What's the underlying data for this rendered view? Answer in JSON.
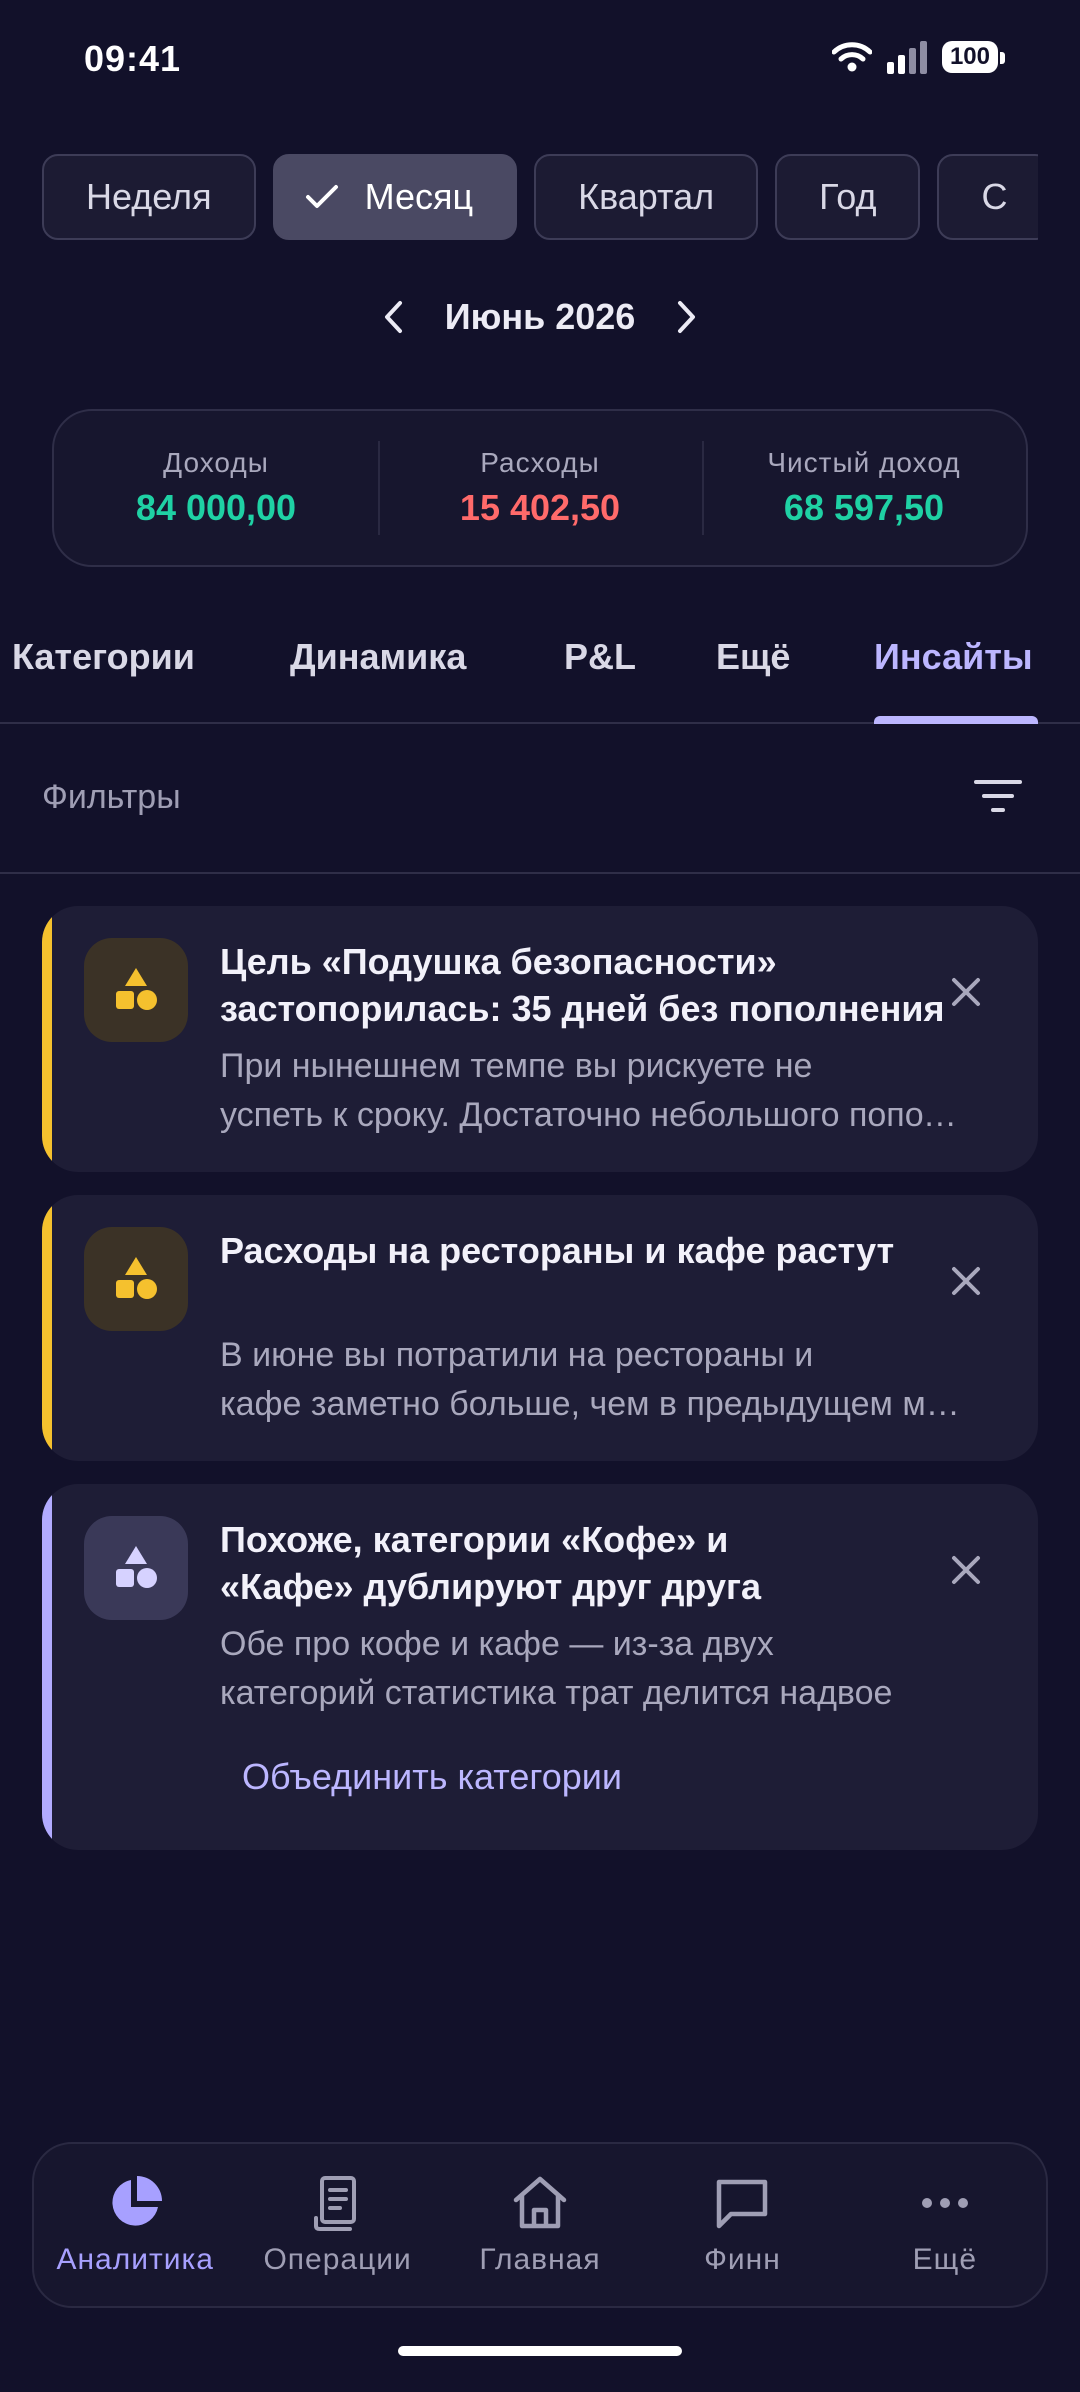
{
  "status": {
    "time": "09:41",
    "battery": "100"
  },
  "periods": [
    "Неделя",
    "Месяц",
    "Квартал",
    "Год",
    "С"
  ],
  "selected_period": "Месяц",
  "month": "Июнь 2026",
  "summary": {
    "income_label": "Доходы",
    "income_value": "84 000,00",
    "income_color": "#1fd1a4",
    "expense_label": "Расходы",
    "expense_value": "15 402,50",
    "expense_color": "#ff6a6a",
    "net_label": "Чистый доход",
    "net_value": "68 597,50",
    "net_color": "#1fd1a4"
  },
  "tabs": [
    "Категории",
    "Динамика",
    "P&L",
    "Ещё",
    "Инсайты"
  ],
  "active_tab": "Инсайты",
  "filters_label": "Фильтры",
  "insights": [
    {
      "title": "Цель «Подушка безопасности» застопорилась: 35 дней без пополнения",
      "body": "При нынешнем темпе вы рискуете не успеть к сроку. Достаточно небольшого пополнения",
      "accent": "#f5c12e"
    },
    {
      "title": "Расходы на рестораны и кафе растут",
      "body": "В июне вы потратили на рестораны и кафе заметно больше, чем в предыдущем месяце",
      "accent": "#f5c12e"
    },
    {
      "title": "Похоже, категории «Кофе» и «Кафе» дублируют друг друга",
      "body": "Обе про кофе и кафе — из-за двух категорий статистика трат делится надвое",
      "accent": "#b2abff",
      "action": "Объединить категории"
    }
  ],
  "bottom_nav": [
    "Аналитика",
    "Операции",
    "Главная",
    "Финн",
    "Ещё"
  ],
  "active_nav": "Аналитика"
}
